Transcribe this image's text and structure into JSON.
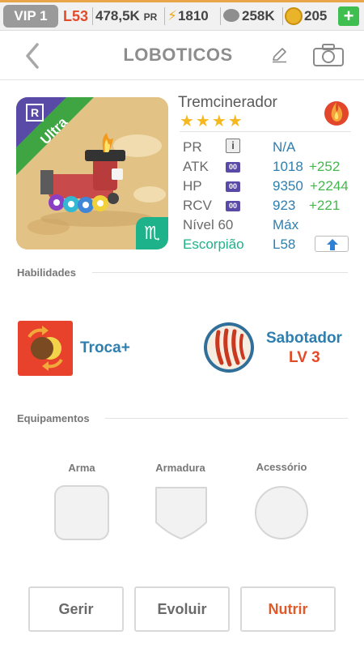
{
  "status_bar": {
    "vip": "VIP 1",
    "level": "L53",
    "power": "478,5K",
    "power_unit": "PR",
    "energy": "1810",
    "pawprints": "258K",
    "coins": "205",
    "add_label": "+"
  },
  "header": {
    "title": "LOBOTICOS",
    "icons": [
      "back-arrow-icon",
      "edit-pencil-icon",
      "camera-icon"
    ]
  },
  "monster": {
    "name": "Tremcinerador",
    "stars": "★★★★",
    "rarity_badge": "R",
    "tier": "Ultra",
    "element": "fire",
    "zodiac_symbol": "♏",
    "stats": {
      "pr_label": "PR",
      "pr_value": "N/A",
      "pr_info": "i",
      "atk_label": "ATK",
      "atk_badge": "00",
      "atk_value": "1018",
      "atk_bonus": "+252",
      "hp_label": "HP",
      "hp_badge": "00",
      "hp_value": "9350",
      "hp_bonus": "+2244",
      "rcv_label": "RCV",
      "rcv_badge": "00",
      "rcv_value": "923",
      "rcv_bonus": "+221",
      "level_label": "Nível 60",
      "level_value": "Máx",
      "zodiac_label": "Escorpião",
      "zodiac_level": "L58"
    }
  },
  "skills": {
    "section_title": "Habilidades",
    "skill1_name": "Troca+",
    "skill2_name": "Sabotador",
    "skill2_level": "LV 3"
  },
  "equipment": {
    "section_title": "Equipamentos",
    "weapon_label": "Arma",
    "armor_label": "Armadura",
    "accessory_label": "Acessório"
  },
  "actions": {
    "manage": "Gerir",
    "evolve": "Evoluir",
    "feed": "Nutrir"
  },
  "colors": {
    "accent_blue": "#2f7fae",
    "bonus_green": "#44b84c",
    "zodiac_teal": "#1db28a",
    "alert_red": "#e24b2a",
    "tier_purple": "#5a4aa8"
  }
}
